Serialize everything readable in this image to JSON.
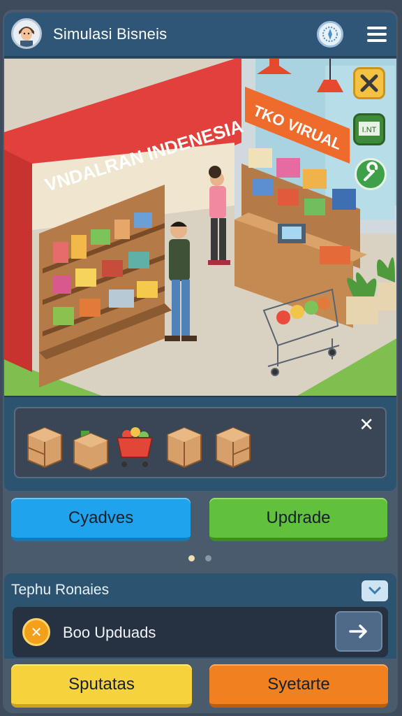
{
  "header": {
    "title": "Simulasi Bisneis",
    "avatar_icon": "player-avatar",
    "compass_icon": "compass-icon",
    "menu_icon": "hamburger-menu-icon"
  },
  "scene": {
    "store_sign": "VNDALRAN INDENESIA",
    "virtual_sign": "TKO VIRUAL",
    "tool_board_label": "I.NT",
    "tools": [
      "hammer-wrench-icon",
      "board-icon",
      "wrench-icon"
    ]
  },
  "inventory": {
    "items": [
      "cardboard-box-icon",
      "box-with-produce-icon",
      "shopping-cart-icon",
      "cardboard-box-icon",
      "cardboard-box-icon"
    ],
    "close_label": "✕"
  },
  "actions": {
    "primary": "Cyadves",
    "upgrade": "Updrade"
  },
  "pager": {
    "count": 2,
    "active": 0
  },
  "notice": {
    "title": "Tephu Ronaies",
    "collapse_icon": "chevron-down-icon",
    "item_text": "Boo Upduads",
    "item_icon": "close-circle-icon",
    "go_icon": "arrow-right-icon"
  },
  "bottom": {
    "left": "Sputatas",
    "right": "Syetarte"
  },
  "colors": {
    "header": "#2f5677",
    "blue": "#1fa3ec",
    "green": "#62c13c",
    "yellow": "#f6d33c",
    "orange": "#f1801f"
  }
}
